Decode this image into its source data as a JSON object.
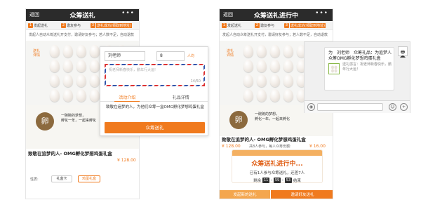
{
  "colors": {
    "accent": "#f07a1e",
    "topbar": "#2b2b2b",
    "panel": "#f5f5f3"
  },
  "phone1": {
    "back": "返回",
    "title": "众筹送礼",
    "more": "•••",
    "steps": [
      {
        "n": "1",
        "label": "发起送礼"
      },
      {
        "n": "2",
        "label": "邀友参与"
      },
      {
        "n": "3",
        "label": "送礼成功(领取到地址)"
      }
    ],
    "hint": "发起人自动众筹送礼开支付，邀请好友参与；若人数不足，自动退款",
    "egg_label": "送礼详情",
    "poem": [
      "一碗碗的梦想，",
      "孵化一年，一起来孵化"
    ],
    "product_title": "致敬在追梦的人- OMG孵化梦想鸡蛋礼盒",
    "price": "¥ 128.00",
    "props_label": "性质:",
    "options": [
      {
        "label": "礼盒卡"
      },
      {
        "label": "鸡蛋礼盒"
      }
    ]
  },
  "dialog": {
    "name_value": "刘老师",
    "count_value": "8",
    "count_unit": "人均",
    "placeholder": "祝老师新春快乐，鹏年行大运!",
    "char_count": "14/50",
    "tabs": [
      {
        "label": "活动介绍"
      },
      {
        "label": "礼品详情"
      }
    ],
    "description": "致敬在追梦的人，为他们众筹一盒OMG孵化梦想鸡蛋礼盒",
    "submit": "众筹送礼"
  },
  "phone2": {
    "back": "返回",
    "title": "众筹送礼进行中",
    "more": "•••",
    "steps": [
      {
        "n": "1",
        "label": "发起送礼"
      },
      {
        "n": "2",
        "label": "邀友参与"
      },
      {
        "n": "3",
        "label": "送礼成功(领取到地址)"
      }
    ],
    "hint": "发起人自动众筹送礼开支付，邀请好友参与；若人数不足，自动退款",
    "egg_label": "送礼详情",
    "poem": [
      "一碗碗的梦想，",
      "孵化一年，一起来孵化"
    ],
    "product_title": "致敬在追梦的人- OMG孵化梦想鸡蛋礼盒",
    "price_left": "¥ 128.00",
    "price_mid": "共8人参与，每人众筹份额:",
    "price_right": "¥ 16.00",
    "banner_title": "众筹送礼进行中...",
    "banner_line2": "已有1人参与众筹送礼，还差7人",
    "banner_prefix": "剩余",
    "timer": [
      "11",
      "59",
      "53"
    ],
    "banner_suffix": "结束",
    "btn_left": "发起新的送礼",
    "btn_right": "邀请好友送礼"
  },
  "chat": {
    "message": "为　刘老师　众筹礼品：为追梦人众筹OMG孵化梦想鸡蛋礼盒",
    "sub": "送礼感言：祝老师新春快乐，鹏年行大运！",
    "input_icon_left": "voice-icon",
    "input_icon_right": "plus-icon"
  }
}
